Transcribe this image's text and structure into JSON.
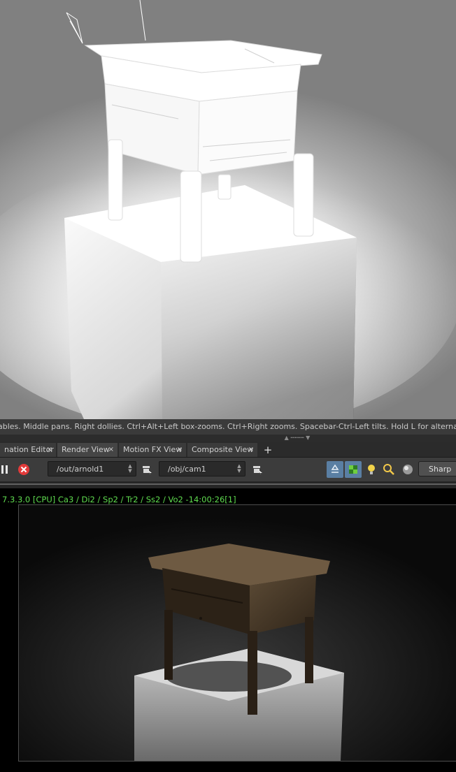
{
  "viewport": {
    "status_text": "ables. Middle pans. Right dollies. Ctrl+Alt+Left box-zooms. Ctrl+Right zooms. Spacebar-Ctrl-Left tilts. Hold L for alternate tumble, dolly"
  },
  "tabs": [
    {
      "label": "nation Editor",
      "active": false
    },
    {
      "label": "Render View",
      "active": true
    },
    {
      "label": "Motion FX View",
      "active": false
    },
    {
      "label": "Composite View",
      "active": false
    }
  ],
  "tab_close_glyph": "×",
  "tab_add_glyph": "+",
  "toolbar": {
    "render_node": "/out/arnold1",
    "camera": "/obj/cam1",
    "sharp_label": "Sharp",
    "icons": [
      "pause-icon",
      "stop-render-icon",
      "render-node-picker-icon",
      "camera-picker-icon",
      "recycle-icon",
      "checker-icon",
      "light-bulb-icon",
      "magnify-icon",
      "sphere-icon"
    ]
  },
  "render_view": {
    "info": "7.3.3.0 [CPU]  Ca3 / Di2 / Sp2 / Tr2 / Ss2 / Vo2 -14:00:26[1]"
  },
  "colors": {
    "info_text": "#5fdc4f",
    "stop_icon": "#e23a3a",
    "panel_bg": "#3c3c3c"
  }
}
